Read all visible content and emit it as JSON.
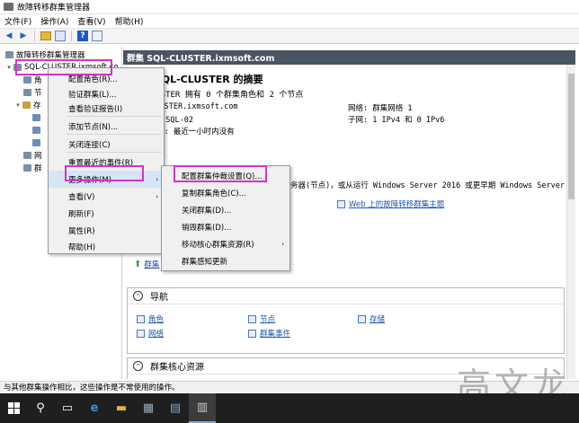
{
  "window": {
    "title": "故障转移群集管理器"
  },
  "menu": [
    "文件(F)",
    "操作(A)",
    "查看(V)",
    "帮助(H)"
  ],
  "tree": {
    "root": "故障转移群集管理器",
    "cluster": "SQL-CLUSTER.ixmsoft.co",
    "children": [
      "角",
      "节",
      "存",
      "",
      "网",
      "群"
    ]
  },
  "content": {
    "header": "群集 SQL-CLUSTER.ixmsoft.com",
    "summary_title": "集 SQL-CLUSTER 的摘要",
    "summary_sub": "-CLUSTER 拥有 0 个群集角色和 2 个节点",
    "left_kv": [
      "L-CLUSTER.ixmsoft.com",
      "务器: SQL-02",
      "集事件: 最近一小时内没有"
    ],
    "right_kv": [
      "网络: 群集网络 1",
      "子网: 1 IPv4 和 0 IPv6"
    ],
    "desc_text": "务器(节点)，或从运行 Windows Server 2016 或更早期 Windows Server 版",
    "web_link": "Web 上的故障转移群集主题",
    "partial_link": "群集",
    "nav_title": "导航",
    "nav_items": [
      "角色",
      "节点",
      "存储",
      "网络",
      "群集事件"
    ],
    "core_title": "群集核心资源"
  },
  "context_menu": {
    "items": [
      "配置角色(R)...",
      "验证群集(L)...",
      "查看验证报告(I)",
      "添加节点(N)...",
      "关闭连接(C)",
      "重置最近的事件(R)",
      "更多操作(M)",
      "查看(V)",
      "刷新(F)",
      "属性(R)",
      "帮助(H)"
    ]
  },
  "submenu": {
    "items": [
      "配置群集仲裁设置(Q)...",
      "复制群集角色(C)...",
      "关闭群集(D)...",
      "销毁群集(D)...",
      "移动核心群集资源(R)",
      "群集感知更新"
    ]
  },
  "statusbar": "与其他群集操作相比，这些操作是不常使用的操作。",
  "watermark": "高文龙",
  "colors": {
    "highlight": "#d633c8",
    "header": "#4a5563",
    "link": "#1a56b4"
  }
}
